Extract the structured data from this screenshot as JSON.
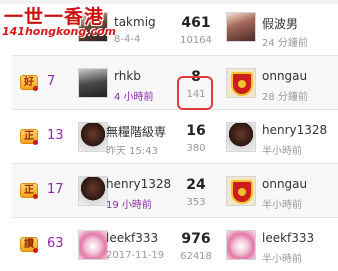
{
  "watermark": {
    "main": "一世一香港",
    "sub": "141hongkong.com"
  },
  "rows": [
    {
      "badge": "",
      "count": "",
      "left_user": "takmig",
      "left_time": "8-4-4",
      "big": "461",
      "small": "10164",
      "right_user": "假波男",
      "right_time": "24 分鐘前"
    },
    {
      "badge": "好",
      "count": "7",
      "left_user": "rhkb",
      "left_time": "4 小時前",
      "big": "8",
      "small": "141",
      "right_user": "onngau",
      "right_time": "28 分鐘前"
    },
    {
      "badge": "正",
      "count": "13",
      "left_user": "無糧階級専",
      "left_time": "昨天 15:43",
      "big": "16",
      "small": "380",
      "right_user": "henry1328",
      "right_time": "半小時前"
    },
    {
      "badge": "正",
      "count": "17",
      "left_user": "henry1328",
      "left_time": "19 小時前",
      "big": "24",
      "small": "353",
      "right_user": "onngau",
      "right_time": "半小時前"
    },
    {
      "badge": "讚",
      "count": "63",
      "left_user": "leekf333",
      "left_time": "2017-11-19",
      "big": "976",
      "small": "62418",
      "right_user": "leekf333",
      "right_time": "半小時前"
    }
  ],
  "colors": {
    "highlight": "#e23b3b",
    "count": "#8a2aa8",
    "logo_red": "#cc1010"
  }
}
